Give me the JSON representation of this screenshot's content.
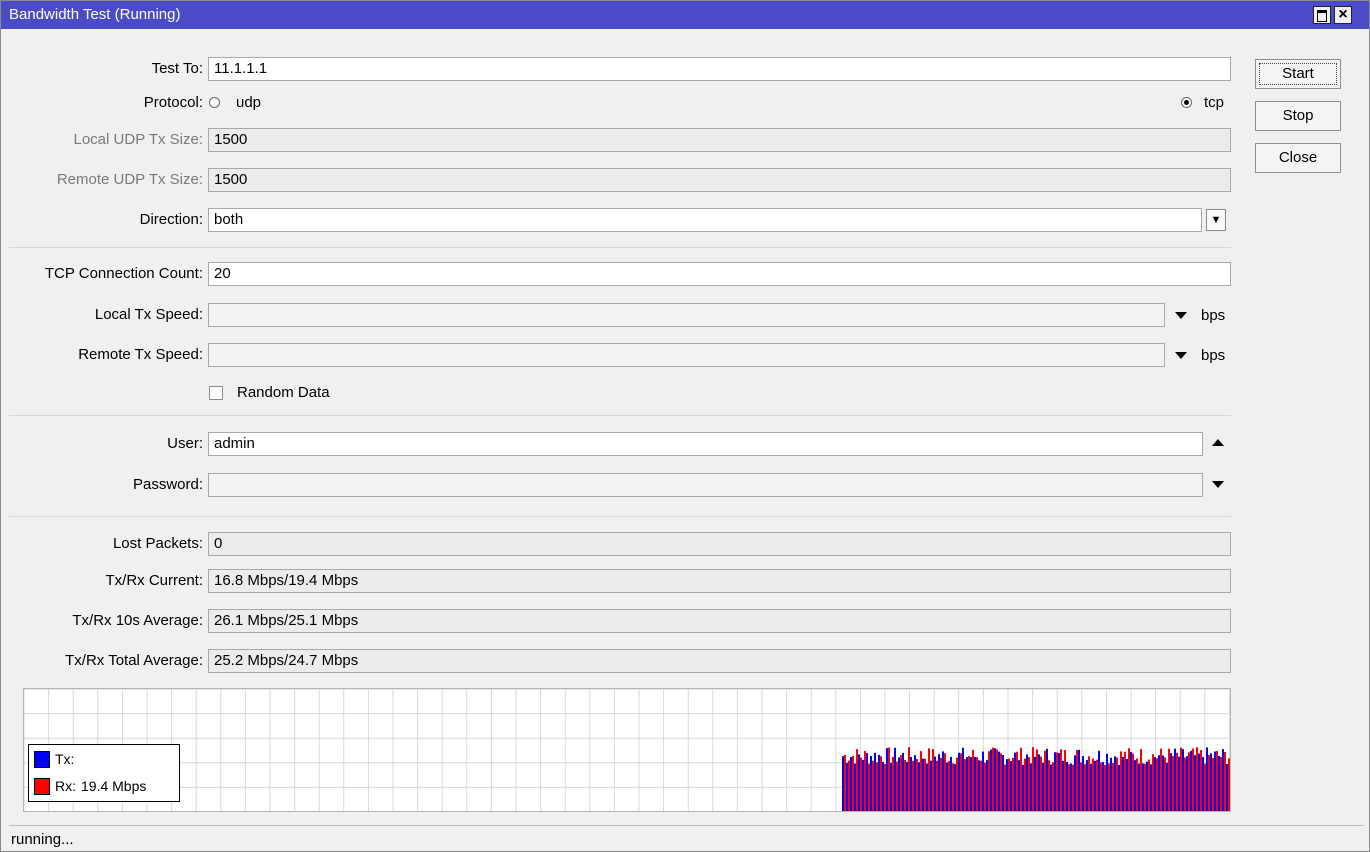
{
  "window": {
    "title": "Bandwidth Test (Running)"
  },
  "buttons": {
    "start": "Start",
    "stop": "Stop",
    "close": "Close"
  },
  "form": {
    "test_to": {
      "label": "Test To:",
      "value": "11.1.1.1"
    },
    "protocol": {
      "label": "Protocol:",
      "options": [
        "udp",
        "tcp"
      ],
      "selected": "tcp"
    },
    "local_udp_tx_size": {
      "label": "Local UDP Tx Size:",
      "value": "1500"
    },
    "remote_udp_tx_size": {
      "label": "Remote UDP Tx Size:",
      "value": "1500"
    },
    "direction": {
      "label": "Direction:",
      "value": "both"
    },
    "tcp_connection_count": {
      "label": "TCP Connection Count:",
      "value": "20"
    },
    "local_tx_speed": {
      "label": "Local Tx Speed:",
      "value": "",
      "unit": "bps"
    },
    "remote_tx_speed": {
      "label": "Remote Tx Speed:",
      "value": "",
      "unit": "bps"
    },
    "random_data": {
      "label": "Random Data",
      "checked": false
    },
    "user": {
      "label": "User:",
      "value": "admin"
    },
    "password": {
      "label": "Password:",
      "value": ""
    }
  },
  "results": {
    "lost_packets": {
      "label": "Lost Packets:",
      "value": "0"
    },
    "current": {
      "label": "Tx/Rx Current:",
      "value": "16.8 Mbps/19.4 Mbps"
    },
    "avg10s": {
      "label": "Tx/Rx 10s Average:",
      "value": "26.1 Mbps/25.1 Mbps"
    },
    "total_avg": {
      "label": "Tx/Rx Total Average:",
      "value": "25.2 Mbps/24.7 Mbps"
    }
  },
  "graph": {
    "legend": {
      "tx_label": "Tx:",
      "rx_label": "Rx:",
      "rx_value": "19.4 Mbps"
    },
    "colors": {
      "tx": "#0000ff",
      "rx": "#ff0000",
      "grid": "#d8d8d8"
    }
  },
  "status": "running..."
}
